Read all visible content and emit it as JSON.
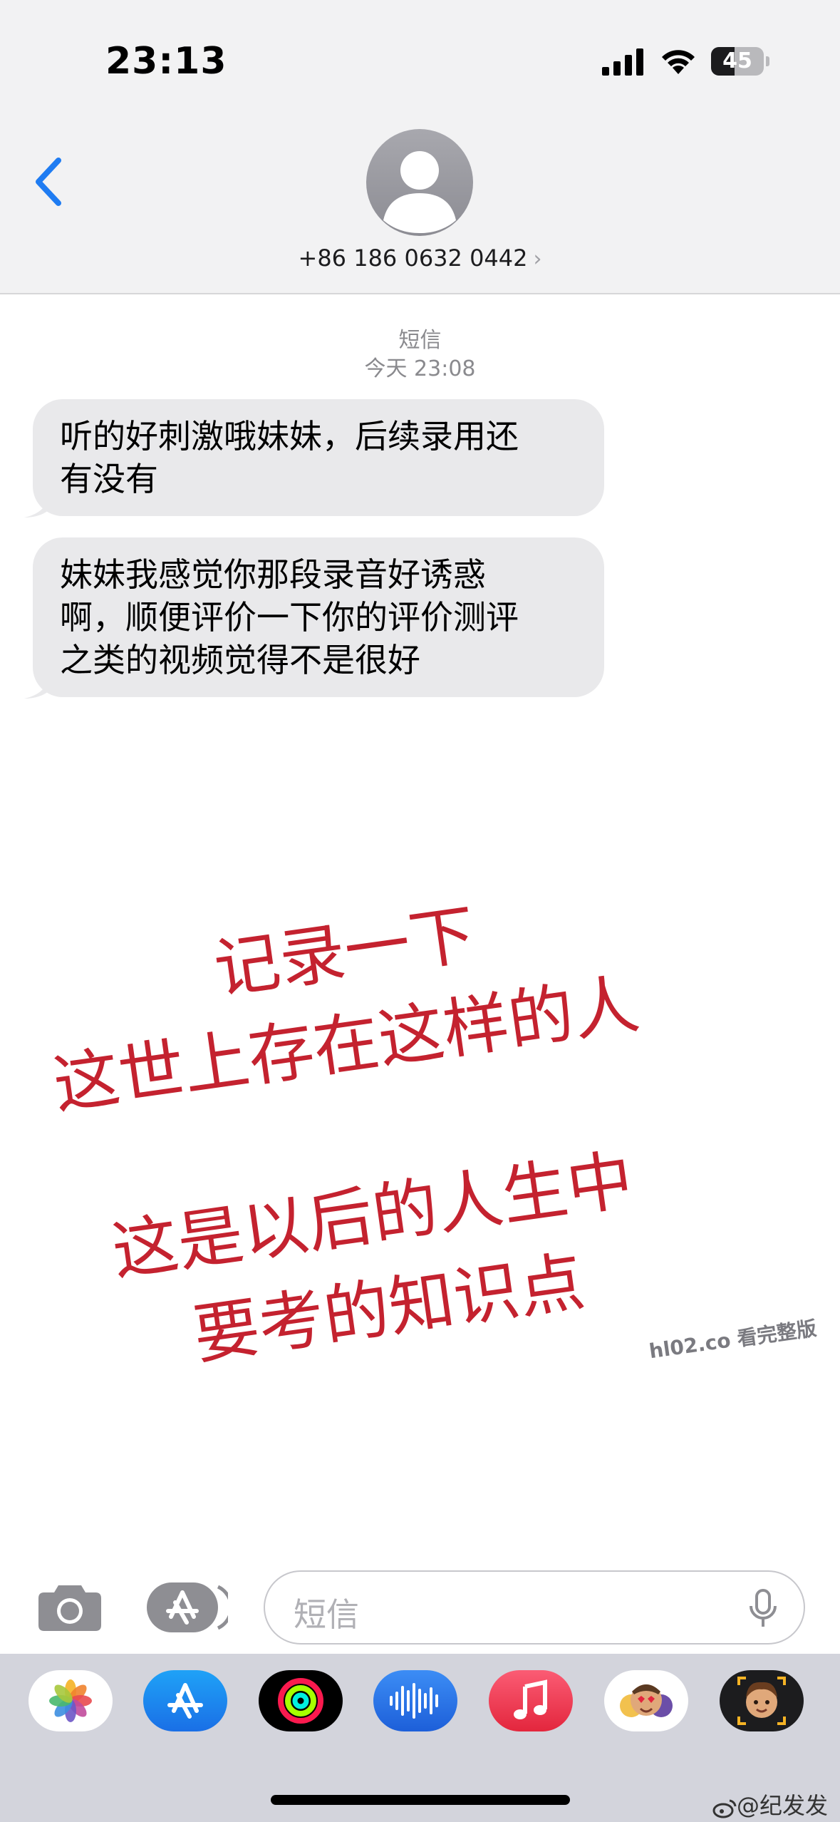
{
  "status_bar": {
    "time": "23:13",
    "battery": "45",
    "battery_level": 0.45
  },
  "header": {
    "contact": "+86 186 0632 0442",
    "chevron": "›"
  },
  "thread": {
    "service": "短信",
    "timestamp": "今天 23:08",
    "messages": [
      {
        "lines": [
          "听的好刺激哦妹妹，后续录用还",
          "有没有"
        ]
      },
      {
        "lines": [
          "妹妹我感觉你那段录音好诱惑",
          "啊，顺便评价一下你的评价测评",
          "之类的视频觉得不是很好"
        ]
      }
    ]
  },
  "overlay": {
    "line1": "记录一下",
    "line2": "这世上存在这样的人",
    "line3": "这是以后的人生中",
    "line4": "要考的知识点",
    "watermark": "hl02.co 看完整版",
    "color": "#c4222f"
  },
  "input": {
    "placeholder": "短信"
  },
  "tray_icons": [
    "photos-icon",
    "app-store-icon",
    "activity-icon",
    "voice-memos-icon",
    "music-icon",
    "memoji-stickers-icon",
    "memoji-icon"
  ],
  "footer_watermark": "@纪发发"
}
